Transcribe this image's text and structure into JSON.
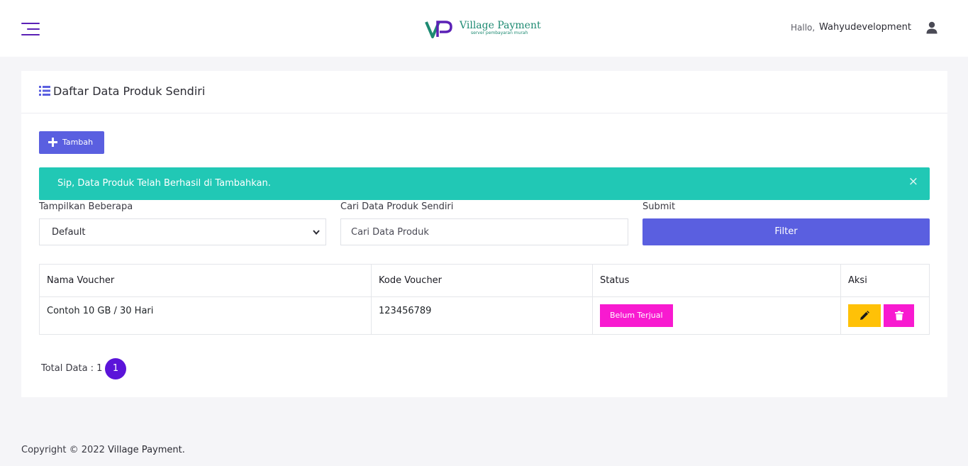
{
  "header": {
    "logo_title": "Village Payment",
    "logo_subtitle": "server pembayaran murah",
    "greeting": "Hallo,",
    "username": "Wahyudevelopment",
    "menu_icon": "hamburger-menu-icon",
    "user_icon": "user-icon"
  },
  "card": {
    "title": "Daftar Data Produk Sendiri",
    "title_icon": "list-icon",
    "add_label": "Tambah",
    "alert_text": "Sip, Data Produk Telah Berhasil di Tambahkan.",
    "alert_close": "×"
  },
  "filters": {
    "show_label": "Tampilkan Beberapa",
    "show_value": "Default",
    "search_label": "Cari Data Produk Sendiri",
    "search_placeholder": "Cari Data Produk",
    "submit_label": "Submit",
    "filter_button": "Filter"
  },
  "table": {
    "columns": [
      "Nama Voucher",
      "Kode Voucher",
      "Status",
      "Aksi"
    ],
    "rows": [
      {
        "nama": "Contoh 10 GB / 30 Hari",
        "kode": "123456789",
        "status": "Belum Terjual"
      }
    ]
  },
  "pagination": {
    "total_text": "Total Data : 1",
    "current_page": "1"
  },
  "footer": {
    "copyright": "Copyright © 2022",
    "brand": "Village Payment."
  },
  "colors": {
    "primary": "#5a5fe0",
    "accent_purple": "#5b14d9",
    "success_alert": "#21c8b5",
    "badge_pink": "#f81ad0",
    "edit_yellow": "#ffc107",
    "logo_green": "#1d8a72"
  }
}
